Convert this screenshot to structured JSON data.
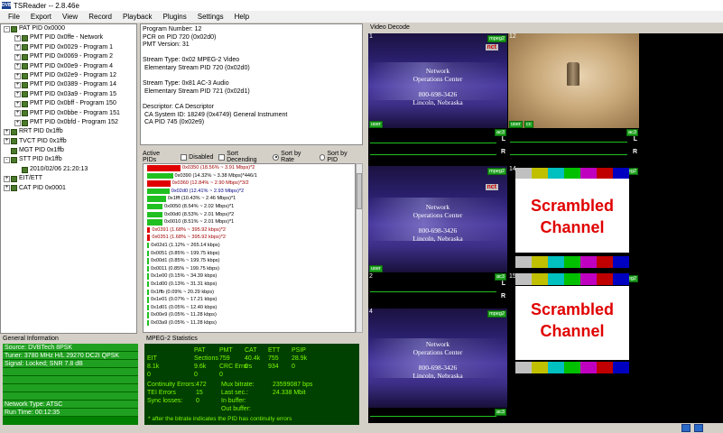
{
  "window": {
    "app_icon": "DVB",
    "title": "TSReader -- 2.8.46e"
  },
  "menu": [
    "File",
    "Export",
    "View",
    "Record",
    "Playback",
    "Plugins",
    "Settings",
    "Help"
  ],
  "tree": [
    {
      "depth": 0,
      "exp": "-",
      "label": "PAT PID 0x0000"
    },
    {
      "depth": 1,
      "exp": "+",
      "label": "PMT PID 0x0ffe - Network"
    },
    {
      "depth": 1,
      "exp": "+",
      "label": "PMT PID 0x0029 - Program 1"
    },
    {
      "depth": 1,
      "exp": "+",
      "label": "PMT PID 0x0069 - Program 2"
    },
    {
      "depth": 1,
      "exp": "+",
      "label": "PMT PID 0x00e9 - Program 4"
    },
    {
      "depth": 1,
      "exp": "+",
      "label": "PMT PID 0x02e9 - Program 12"
    },
    {
      "depth": 1,
      "exp": "+",
      "label": "PMT PID 0x0389 - Program 14"
    },
    {
      "depth": 1,
      "exp": "+",
      "label": "PMT PID 0x03a9 - Program 15"
    },
    {
      "depth": 1,
      "exp": "+",
      "label": "PMT PID 0x0bff - Program 150"
    },
    {
      "depth": 1,
      "exp": "+",
      "label": "PMT PID 0x0bbe - Program 151"
    },
    {
      "depth": 1,
      "exp": "+",
      "label": "PMT PID 0x0bfd - Program 152"
    },
    {
      "depth": 0,
      "exp": "+",
      "label": "RRT PID 0x1ffb"
    },
    {
      "depth": 0,
      "exp": "+",
      "label": "TVCT PID 0x1ffb"
    },
    {
      "depth": 0,
      "exp": "",
      "label": "MGT PID 0x1ffb"
    },
    {
      "depth": 0,
      "exp": "-",
      "label": "STT PID 0x1ffb"
    },
    {
      "depth": 1,
      "exp": "",
      "label": "2010/02/06 21:20:13"
    },
    {
      "depth": 0,
      "exp": "+",
      "label": "EIT/ETT"
    },
    {
      "depth": 0,
      "exp": "+",
      "label": "CAT PID 0x0001"
    }
  ],
  "info_lines": [
    "Program Number: 12",
    "PCR on PID 720 (0x02d0)",
    "PMT Version: 31",
    "",
    "Stream Type: 0x02 MPEG-2 Video",
    " Elementary Stream PID 720 (0x02d0)",
    "",
    "Stream Type: 0x81 AC-3 Audio",
    " Elementary Stream PID 721 (0x02d1)",
    "",
    "Descriptor: CA Descriptor",
    " CA System ID: 18249 (0x4749) General Instrument",
    " CA PID 745 (0x02e9)"
  ],
  "active_pids": {
    "label": "Active PIDs",
    "disabled": "Disabled",
    "sort_desc": "Sort Decending",
    "sort_rate": "Sort by Rate",
    "sort_pid": "Sort by PID"
  },
  "pids": [
    {
      "text": "0x0350 (18.56% ~ 3.91 Mbps)*2",
      "pct": 18.56,
      "color": "#e00000",
      "tc": "#a00000"
    },
    {
      "text": "0x0390 (14.32% ~ 3.38 Mbps)*446/1",
      "pct": 14.32,
      "color": "#20c020",
      "tc": "#000000"
    },
    {
      "text": "0x0360 (12.84% ~ 2.90 Mbps)*3/2",
      "pct": 12.84,
      "color": "#e00000",
      "tc": "#a00000"
    },
    {
      "text": "0x02d0 (12.41% ~ 2.93 Mbps)*2",
      "pct": 12.41,
      "color": "#20c020",
      "tc": "#000080"
    },
    {
      "text": "0x1fff (10.43% ~ 2.46 Mbps)*1",
      "pct": 10.43,
      "color": "#20c020",
      "tc": "#000000"
    },
    {
      "text": "0x0050 (8.54% ~ 2.02 Mbps)*1",
      "pct": 8.54,
      "color": "#20c020",
      "tc": "#000000"
    },
    {
      "text": "0x00d0 (8.53% ~ 2.01 Mbps)*2",
      "pct": 8.53,
      "color": "#20c020",
      "tc": "#000000"
    },
    {
      "text": "0x0010 (8.51% ~ 2.01 Mbps)*1",
      "pct": 8.51,
      "color": "#20c020",
      "tc": "#000000"
    },
    {
      "text": "0x0391 (1.68% ~ 395.92 kbps)*2",
      "pct": 1.68,
      "color": "#e00000",
      "tc": "#a00000"
    },
    {
      "text": "0x0351 (1.68% ~ 395.92 kbps)*2",
      "pct": 1.68,
      "color": "#e00000",
      "tc": "#a00000"
    },
    {
      "text": "0x02d1 (1.12% ~ 265.14 kbps)",
      "pct": 1.12,
      "color": "#20c020",
      "tc": "#000000"
    },
    {
      "text": "0x0051 (0.85% ~ 199.75 kbps)",
      "pct": 0.85,
      "color": "#20c020",
      "tc": "#000000"
    },
    {
      "text": "0x00d1 (0.85% ~ 199.75 kbps)",
      "pct": 0.85,
      "color": "#20c020",
      "tc": "#000000"
    },
    {
      "text": "0x0011 (0.85% ~ 199.75 kbps)",
      "pct": 0.85,
      "color": "#20c020",
      "tc": "#000000"
    },
    {
      "text": "0x1e00 (0.15% ~ 34.39 kbps)",
      "pct": 0.15,
      "color": "#20c020",
      "tc": "#000000"
    },
    {
      "text": "0x1d00 (0.13% ~ 31.31 kbps)",
      "pct": 0.13,
      "color": "#20c020",
      "tc": "#000000"
    },
    {
      "text": "0x1ffb (0.09% ~ 20.29 kbps)",
      "pct": 0.09,
      "color": "#20c020",
      "tc": "#000000"
    },
    {
      "text": "0x1e01 (0.07% ~ 17.21 kbps)",
      "pct": 0.07,
      "color": "#20c020",
      "tc": "#000000"
    },
    {
      "text": "0x1d01 (0.05% ~ 12.40 kbps)",
      "pct": 0.05,
      "color": "#20c020",
      "tc": "#000000"
    },
    {
      "text": "0x00e9 (0.05% ~ 11.28 kbps)",
      "pct": 0.05,
      "color": "#20c020",
      "tc": "#000000"
    },
    {
      "text": "0x03a9 (0.05% ~ 11.28 kbps)",
      "pct": 0.05,
      "color": "#20c020",
      "tc": "#000000"
    }
  ],
  "general_info": {
    "label": "General Information",
    "rows": [
      "Source: DVBTech 8PSK",
      "Tuner: 3780 MHz H/L 29270 DC2I QPSK",
      "Signal: Locked; SNR 7.8 dB",
      "",
      "",
      "",
      "",
      "Network Type: ATSC",
      "Run Time: 00:12:35"
    ]
  },
  "mpeg_stats": {
    "label": "MPEG-2 Statistics",
    "headers": [
      "",
      "PAT",
      "PMT",
      "CAT",
      "ETT",
      "PSIP",
      "EIT"
    ],
    "sections": [
      "Sections",
      "759",
      "40.4k",
      "755",
      "28.9k",
      "8.1k",
      "9.6k"
    ],
    "crc": [
      "CRC Errors",
      "0",
      "934",
      "0",
      "0",
      "0",
      "0"
    ],
    "continuity_label": "Continuity Errors:",
    "continuity": "472",
    "mux_label": "Mux bitrate:",
    "mux": "23599087 bps",
    "tei_label": "TEI Errors",
    "tei": "15",
    "last_sec_label": "Last sec.:",
    "last_sec": "24.338 Mbit",
    "sync_label": "Sync losses:",
    "sync": "0",
    "in_buffer_label": "In buffer:",
    "out_buffer_label": "Out buffer:",
    "note": "* after the bitrate indicates the PID has continuity errors"
  },
  "video": {
    "label": "Video Decode",
    "noc": {
      "l1": "Network",
      "l2": "Operations Center",
      "l3": "800-698-3426",
      "l4": "Lincoln, Nebraska",
      "logo": "nct"
    },
    "scrambled": {
      "l1": "Scrambled",
      "l2": "Channel"
    },
    "tag_mpeg": "mpeg2",
    "tag_ac3": "ac3",
    "tag_user": "user",
    "tag_cc": "cc",
    "L": "L",
    "R": "R",
    "nums": [
      "1",
      "12",
      "14",
      "2",
      "15",
      "4"
    ]
  },
  "colors": {
    "bars": [
      "#c0c0c0",
      "#c0c000",
      "#00c0c0",
      "#00c000",
      "#c000c0",
      "#c00000",
      "#0000c0"
    ]
  }
}
